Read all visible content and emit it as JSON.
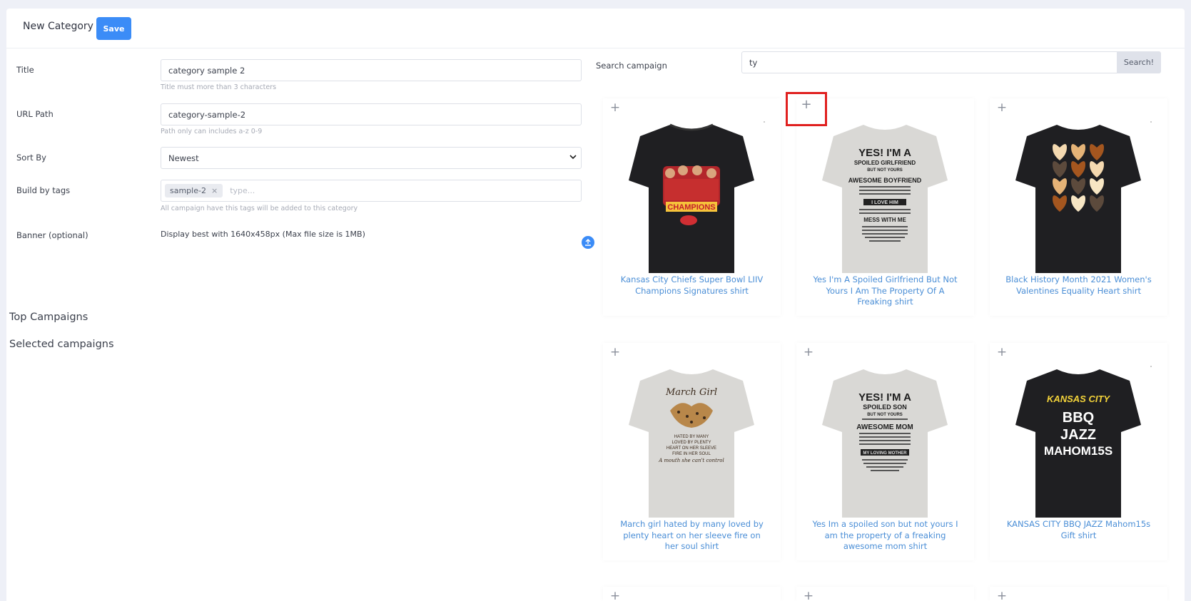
{
  "header": {
    "title": "New Category",
    "save_label": "Save"
  },
  "form": {
    "title": {
      "label": "Title",
      "value": "category sample 2",
      "hint": "Title must more than 3 characters"
    },
    "url": {
      "label": "URL Path",
      "value": "category-sample-2",
      "hint": "Path only can includes a-z 0-9"
    },
    "sort": {
      "label": "Sort By",
      "value": "Newest"
    },
    "tags": {
      "label": "Build by tags",
      "chips": [
        "sample-2"
      ],
      "placeholder": "type...",
      "hint": "All campaign have this tags will be added to this category"
    },
    "banner": {
      "label": "Banner (optional)",
      "text": "Display best with 1640x458px (Max file size is 1MB)"
    }
  },
  "sections": {
    "top": "Top Campaigns",
    "selected": "Selected campaigns"
  },
  "search": {
    "label": "Search campaign",
    "value": "ty",
    "button": "Search!"
  },
  "campaigns": [
    {
      "title": "Kansas City Chiefs Super Bowl LIIV Champions Signatures shirt",
      "shirt_color": "#1f1f22",
      "design": "champions"
    },
    {
      "title": "Yes I'm A Spoiled Girlfriend But Not Yours I Am The Property Of A Freaking shirt",
      "shirt_color": "#d9d8d5",
      "design": "text-girlfriend"
    },
    {
      "title": "Black History Month 2021 Women's Valentines Equality Heart shirt",
      "shirt_color": "#1f1f22",
      "design": "hearts"
    },
    {
      "title": "March girl hated by many loved by plenty heart on her sleeve fire on her soul shirt",
      "shirt_color": "#d9d8d5",
      "design": "lips"
    },
    {
      "title": "Yes Im a spoiled son but not yours I am the property of a freaking awesome mom shirt",
      "shirt_color": "#d9d8d5",
      "design": "text-son"
    },
    {
      "title": "KANSAS CITY BBQ JAZZ Mahom15s Gift shirt",
      "shirt_color": "#1f1f22",
      "design": "bbq"
    }
  ],
  "shirt_texts": {
    "champions": "CHAMPIONS",
    "girlfriend": [
      "YES! I'M A",
      "SPOILED GIRLFRIEND",
      "BUT NOT YOURS",
      "AWESOME BOYFRIEND",
      "I LOVE HIM",
      "MESS WITH ME"
    ],
    "son": [
      "YES! I'M A",
      "SPOILED SON",
      "BUT NOT YOURS",
      "AWESOME MOM",
      "MY LOVING MOTHER"
    ],
    "march": [
      "March Girl",
      "HATED BY MANY",
      "LOVED BY PLENTY",
      "HEART ON HER SLEEVE",
      "FIRE IN HER SOUL",
      "A mouth she can't control"
    ],
    "bbq": [
      "KANSAS CITY",
      "BBQ",
      "JAZZ",
      "MAHOM15S"
    ]
  },
  "colors": {
    "accent": "#3b8cf7",
    "link": "#4a8ed6",
    "highlight": "#e0201f"
  }
}
